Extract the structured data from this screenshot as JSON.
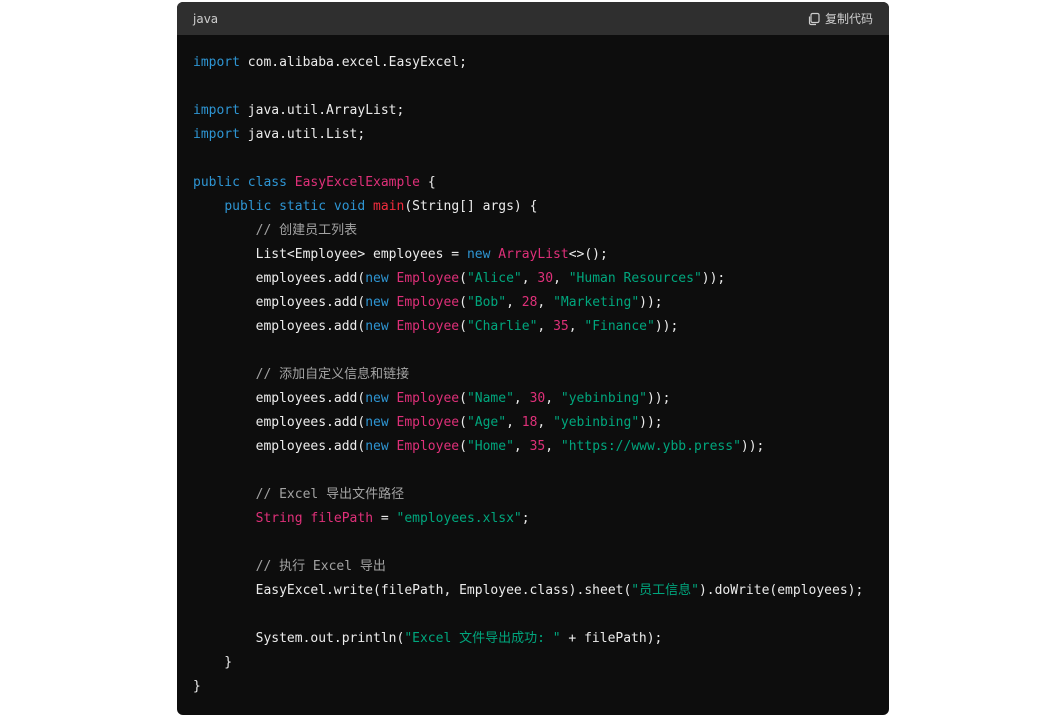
{
  "header": {
    "language": "java",
    "copy_label": "复制代码"
  },
  "code": {
    "lines": [
      [
        [
          "k",
          "import"
        ],
        [
          "p",
          " com.alibaba.excel.EasyExcel;"
        ]
      ],
      [],
      [
        [
          "k",
          "import"
        ],
        [
          "p",
          " java.util.ArrayList;"
        ]
      ],
      [
        [
          "k",
          "import"
        ],
        [
          "p",
          " java.util.List;"
        ]
      ],
      [],
      [
        [
          "k",
          "public"
        ],
        [
          "p",
          " "
        ],
        [
          "k",
          "class"
        ],
        [
          "p",
          " "
        ],
        [
          "c",
          "EasyExcelExample"
        ],
        [
          "p",
          " {"
        ]
      ],
      [
        [
          "p",
          "    "
        ],
        [
          "k",
          "public"
        ],
        [
          "p",
          " "
        ],
        [
          "k",
          "static"
        ],
        [
          "p",
          " "
        ],
        [
          "k",
          "void"
        ],
        [
          "p",
          " "
        ],
        [
          "f",
          "main"
        ],
        [
          "p",
          "(String[] args) {"
        ]
      ],
      [
        [
          "p",
          "        "
        ],
        [
          "cm",
          "// 创建员工列表"
        ]
      ],
      [
        [
          "p",
          "        List<Employee> employees = "
        ],
        [
          "k",
          "new"
        ],
        [
          "p",
          " "
        ],
        [
          "c",
          "ArrayList"
        ],
        [
          "p",
          "<>();"
        ]
      ],
      [
        [
          "p",
          "        employees.add("
        ],
        [
          "k",
          "new"
        ],
        [
          "p",
          " "
        ],
        [
          "c",
          "Employee"
        ],
        [
          "p",
          "("
        ],
        [
          "s",
          "\"Alice\""
        ],
        [
          "p",
          ", "
        ],
        [
          "n",
          "30"
        ],
        [
          "p",
          ", "
        ],
        [
          "s",
          "\"Human Resources\""
        ],
        [
          "p",
          "));"
        ]
      ],
      [
        [
          "p",
          "        employees.add("
        ],
        [
          "k",
          "new"
        ],
        [
          "p",
          " "
        ],
        [
          "c",
          "Employee"
        ],
        [
          "p",
          "("
        ],
        [
          "s",
          "\"Bob\""
        ],
        [
          "p",
          ", "
        ],
        [
          "n",
          "28"
        ],
        [
          "p",
          ", "
        ],
        [
          "s",
          "\"Marketing\""
        ],
        [
          "p",
          "));"
        ]
      ],
      [
        [
          "p",
          "        employees.add("
        ],
        [
          "k",
          "new"
        ],
        [
          "p",
          " "
        ],
        [
          "c",
          "Employee"
        ],
        [
          "p",
          "("
        ],
        [
          "s",
          "\"Charlie\""
        ],
        [
          "p",
          ", "
        ],
        [
          "n",
          "35"
        ],
        [
          "p",
          ", "
        ],
        [
          "s",
          "\"Finance\""
        ],
        [
          "p",
          "));"
        ]
      ],
      [],
      [
        [
          "p",
          "        "
        ],
        [
          "cm",
          "// 添加自定义信息和链接"
        ]
      ],
      [
        [
          "p",
          "        employees.add("
        ],
        [
          "k",
          "new"
        ],
        [
          "p",
          " "
        ],
        [
          "c",
          "Employee"
        ],
        [
          "p",
          "("
        ],
        [
          "s",
          "\"Name\""
        ],
        [
          "p",
          ", "
        ],
        [
          "n",
          "30"
        ],
        [
          "p",
          ", "
        ],
        [
          "s",
          "\"yebinbing\""
        ],
        [
          "p",
          "));"
        ]
      ],
      [
        [
          "p",
          "        employees.add("
        ],
        [
          "k",
          "new"
        ],
        [
          "p",
          " "
        ],
        [
          "c",
          "Employee"
        ],
        [
          "p",
          "("
        ],
        [
          "s",
          "\"Age\""
        ],
        [
          "p",
          ", "
        ],
        [
          "n",
          "18"
        ],
        [
          "p",
          ", "
        ],
        [
          "s",
          "\"yebinbing\""
        ],
        [
          "p",
          "));"
        ]
      ],
      [
        [
          "p",
          "        employees.add("
        ],
        [
          "k",
          "new"
        ],
        [
          "p",
          " "
        ],
        [
          "c",
          "Employee"
        ],
        [
          "p",
          "("
        ],
        [
          "s",
          "\"Home\""
        ],
        [
          "p",
          ", "
        ],
        [
          "n",
          "35"
        ],
        [
          "p",
          ", "
        ],
        [
          "s",
          "\"https://www.ybb.press\""
        ],
        [
          "p",
          "));"
        ]
      ],
      [],
      [
        [
          "p",
          "        "
        ],
        [
          "cm",
          "// Excel 导出文件路径"
        ]
      ],
      [
        [
          "p",
          "        "
        ],
        [
          "c",
          "String"
        ],
        [
          "p",
          " "
        ],
        [
          "c",
          "filePath"
        ],
        [
          "p",
          " = "
        ],
        [
          "s",
          "\"employees.xlsx\""
        ],
        [
          "p",
          ";"
        ]
      ],
      [],
      [
        [
          "p",
          "        "
        ],
        [
          "cm",
          "// 执行 Excel 导出"
        ]
      ],
      [
        [
          "p",
          "        EasyExcel.write(filePath, Employee.class).sheet("
        ],
        [
          "s",
          "\"员工信息\""
        ],
        [
          "p",
          ").doWrite(employees);"
        ]
      ],
      [],
      [
        [
          "p",
          "        System.out.println("
        ],
        [
          "s",
          "\"Excel 文件导出成功: \""
        ],
        [
          "p",
          " + filePath);"
        ]
      ],
      [
        [
          "p",
          "    }"
        ]
      ],
      [
        [
          "p",
          "}"
        ]
      ]
    ]
  }
}
